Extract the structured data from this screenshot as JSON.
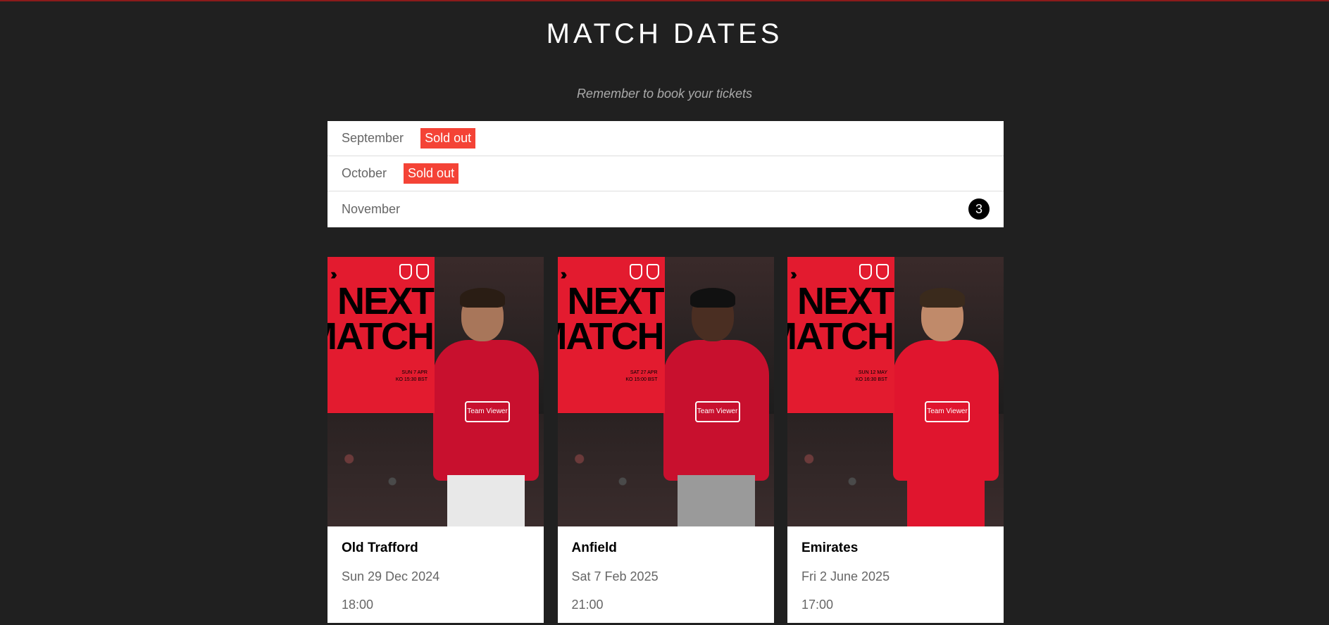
{
  "header": {
    "title": "MATCH DATES",
    "subtitle": "Remember to book your tickets"
  },
  "months": [
    {
      "label": "September",
      "badge": "Sold out"
    },
    {
      "label": "October",
      "badge": "Sold out"
    },
    {
      "label": "November",
      "count": "3"
    }
  ],
  "cards": [
    {
      "poster": {
        "headline_top": "NEXT",
        "headline_bottom": "MATCH",
        "ko_line1": "SUN 7 APR",
        "ko_line2": "KO 15:30 BST",
        "sponsor": "Team Viewer"
      },
      "venue": "Old Trafford",
      "date": "Sun 29 Dec 2024",
      "time": "18:00"
    },
    {
      "poster": {
        "headline_top": "NEXT",
        "headline_bottom": "MATCH",
        "ko_line1": "SAT 27 APR",
        "ko_line2": "KO 15:00 BST",
        "sponsor": "Team Viewer"
      },
      "venue": "Anfield",
      "date": "Sat 7 Feb 2025",
      "time": "21:00"
    },
    {
      "poster": {
        "headline_top": "NEXT",
        "headline_bottom": "MATCH",
        "ko_line1": "SUN 12 MAY",
        "ko_line2": "KO 16:30 BST",
        "sponsor": "Team Viewer"
      },
      "venue": "Emirates",
      "date": "Fri 2 June 2025",
      "time": "17:00"
    }
  ],
  "colors": {
    "background": "#202020",
    "badge": "#f44336",
    "poster_red": "#e31b2f"
  }
}
